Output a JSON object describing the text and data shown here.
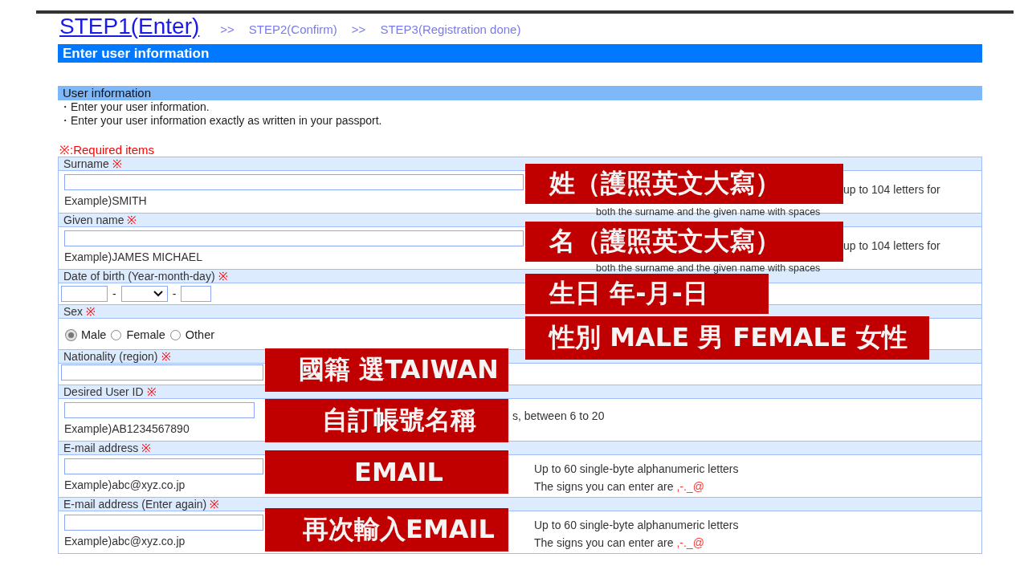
{
  "steps": [
    {
      "label": "STEP1(Enter)",
      "selected": true
    },
    {
      "label": "STEP2(Confirm)",
      "selected": false
    },
    {
      "label": "STEP3(Registration done)",
      "selected": false
    }
  ],
  "step_separators": [
    ">>",
    ">>"
  ],
  "title_bar": "Enter user information",
  "section_title": "User information",
  "notes": [
    "・Enter your user information.",
    "・Enter your user information exactly as written in your passport."
  ],
  "required_note": "※:Required items",
  "fields": [
    {
      "kind": "name",
      "label": "Surname",
      "required_mark": "※",
      "example": "Example)SMITH",
      "hints": [
        {
          "text": "up to 104 letters for"
        },
        {
          "text": "both the surname and the given name with spaces"
        }
      ]
    },
    {
      "kind": "name",
      "label": "Given name",
      "required_mark": "※",
      "example": "Example)JAMES MICHAEL",
      "hints": [
        {
          "text": "up to 104 letters for"
        },
        {
          "text": "both the surname and the given name with spaces"
        }
      ]
    },
    {
      "kind": "date",
      "label": "Date of birth (Year-month-day)",
      "required_mark": "※",
      "separators": [
        "-",
        "-"
      ]
    },
    {
      "kind": "radio",
      "label": "Sex",
      "required_mark": "※",
      "options": [
        {
          "label": "Male",
          "selected": true
        },
        {
          "label": "Female",
          "selected": false
        },
        {
          "label": "Other",
          "selected": false
        }
      ]
    },
    {
      "kind": "wide",
      "label": "Nationality (region)",
      "required_mark": "※"
    },
    {
      "kind": "id",
      "label": "Desired User ID",
      "required_mark": "※",
      "example": "Example)AB1234567890",
      "hints": [
        {
          "text": "s, between 6 to 20"
        }
      ]
    },
    {
      "kind": "email",
      "label": "E-mail address",
      "required_mark": "※",
      "example": "Example)abc@xyz.co.jp",
      "hints": [
        {
          "text": "Up to 60 single-byte alphanumeric letters"
        },
        {
          "text": "The signs you can enter are ",
          "signs": ",-._@"
        }
      ]
    },
    {
      "kind": "email",
      "label": "E-mail address (Enter again)",
      "required_mark": "※",
      "example": "Example)abc@xyz.co.jp",
      "hints": [
        {
          "text": "Up to 60 single-byte alphanumeric letters"
        },
        {
          "text": "The signs you can enter are ",
          "signs": ",-._@"
        }
      ]
    }
  ],
  "annotations": [
    {
      "text": "姓（護照英文大寫）",
      "kind": "right"
    },
    {
      "text": "名（護照英文大寫）",
      "kind": "right"
    },
    {
      "text": "生日 年-月-日",
      "kind": "right"
    },
    {
      "text": "性別 MALE 男 FEMALE 女性",
      "kind": "right"
    },
    {
      "text": "國籍 選TAIWAN",
      "kind": "left"
    },
    {
      "text": "自訂帳號名稱",
      "kind": "left"
    },
    {
      "text": "EMAIL",
      "kind": "left"
    },
    {
      "text": "再次輸入EMAIL",
      "kind": "left"
    }
  ]
}
